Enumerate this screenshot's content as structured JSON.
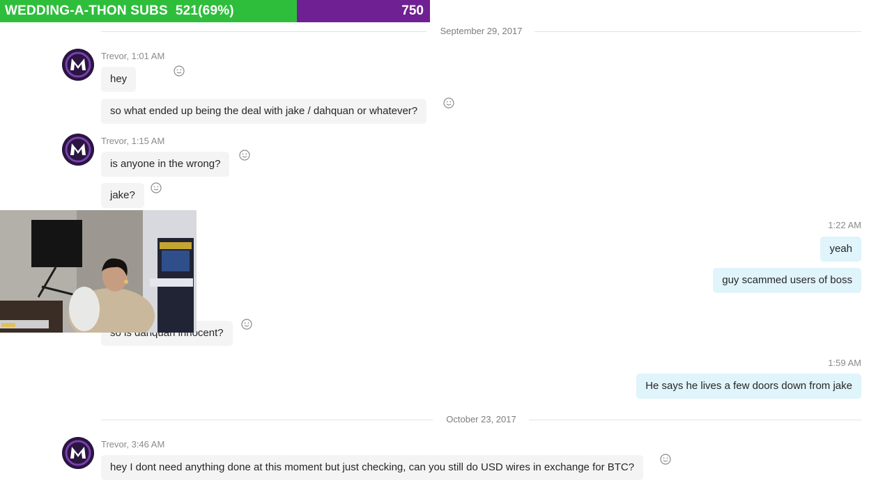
{
  "overlay": {
    "subs_label": "WEDDING-A-THON SUBS  521(69%)",
    "goal_value": "750",
    "progress_fraction": 0.69,
    "colors": {
      "progress": "#2fbe3c",
      "remainder": "#6f2093"
    }
  },
  "chat": {
    "divider_1": "September 29, 2017",
    "divider_2": "October 23, 2017",
    "groups": [
      {
        "meta": "Trevor, 1:01 AM",
        "messages": [
          "hey",
          "so what ended up being the deal with jake / dahquan or whatever?"
        ]
      },
      {
        "meta": "Trevor, 1:15 AM",
        "messages": [
          "is anyone in the wrong?",
          "jake?"
        ]
      },
      {
        "meta": "1:22 AM",
        "messages": [
          "yeah",
          "guy scammed users of boss"
        ]
      },
      {
        "messages": [
          "so is dahquan innocent?"
        ]
      },
      {
        "meta": "1:59 AM",
        "messages": [
          "He says he lives a few doors down from jake"
        ]
      },
      {
        "meta": "Trevor, 3:46 AM",
        "messages": [
          "hey I dont need anything done at this moment but just checking, can you still do USD wires in exchange for BTC?"
        ]
      }
    ],
    "colors": {
      "incoming_bubble": "#f4f4f4",
      "outgoing_bubble": "#dff4fb"
    },
    "icons": {
      "reaction": "smiley-icon",
      "avatar": "m-logo-avatar"
    }
  },
  "webcam": {
    "icon": "webcam-feed"
  }
}
